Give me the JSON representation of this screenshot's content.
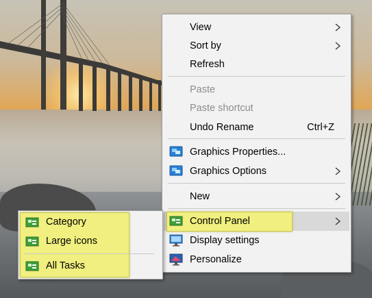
{
  "context_menu": {
    "groups": [
      {
        "items": [
          {
            "label": "View",
            "submenu": true,
            "enabled": true
          },
          {
            "label": "Sort by",
            "submenu": true,
            "enabled": true
          },
          {
            "label": "Refresh",
            "submenu": false,
            "enabled": true
          }
        ]
      },
      {
        "items": [
          {
            "label": "Paste",
            "submenu": false,
            "enabled": false
          },
          {
            "label": "Paste shortcut",
            "submenu": false,
            "enabled": false
          },
          {
            "label": "Undo Rename",
            "shortcut": "Ctrl+Z",
            "submenu": false,
            "enabled": true
          }
        ]
      },
      {
        "items": [
          {
            "label": "Graphics Properties...",
            "icon": "intel-graphics-icon",
            "submenu": false,
            "enabled": true
          },
          {
            "label": "Graphics Options",
            "icon": "intel-graphics-icon",
            "submenu": true,
            "enabled": true
          }
        ]
      },
      {
        "items": [
          {
            "label": "New",
            "submenu": true,
            "enabled": true
          }
        ]
      },
      {
        "items": [
          {
            "label": "Control Panel",
            "icon": "control-panel-icon",
            "submenu": true,
            "enabled": true,
            "highlighted": true
          },
          {
            "label": "Display settings",
            "icon": "display-settings-icon",
            "submenu": false,
            "enabled": true
          },
          {
            "label": "Personalize",
            "icon": "personalize-icon",
            "submenu": false,
            "enabled": true
          }
        ]
      }
    ]
  },
  "control_panel_submenu": {
    "items": [
      {
        "label": "Category",
        "icon": "control-panel-icon"
      },
      {
        "label": "Large icons",
        "icon": "control-panel-icon"
      },
      {
        "label": "All Tasks",
        "icon": "control-panel-icon"
      }
    ]
  },
  "colors": {
    "menu_background": "#f2f2f2",
    "highlight": "#f0ef7f",
    "disabled_text": "#8c8c8c"
  }
}
